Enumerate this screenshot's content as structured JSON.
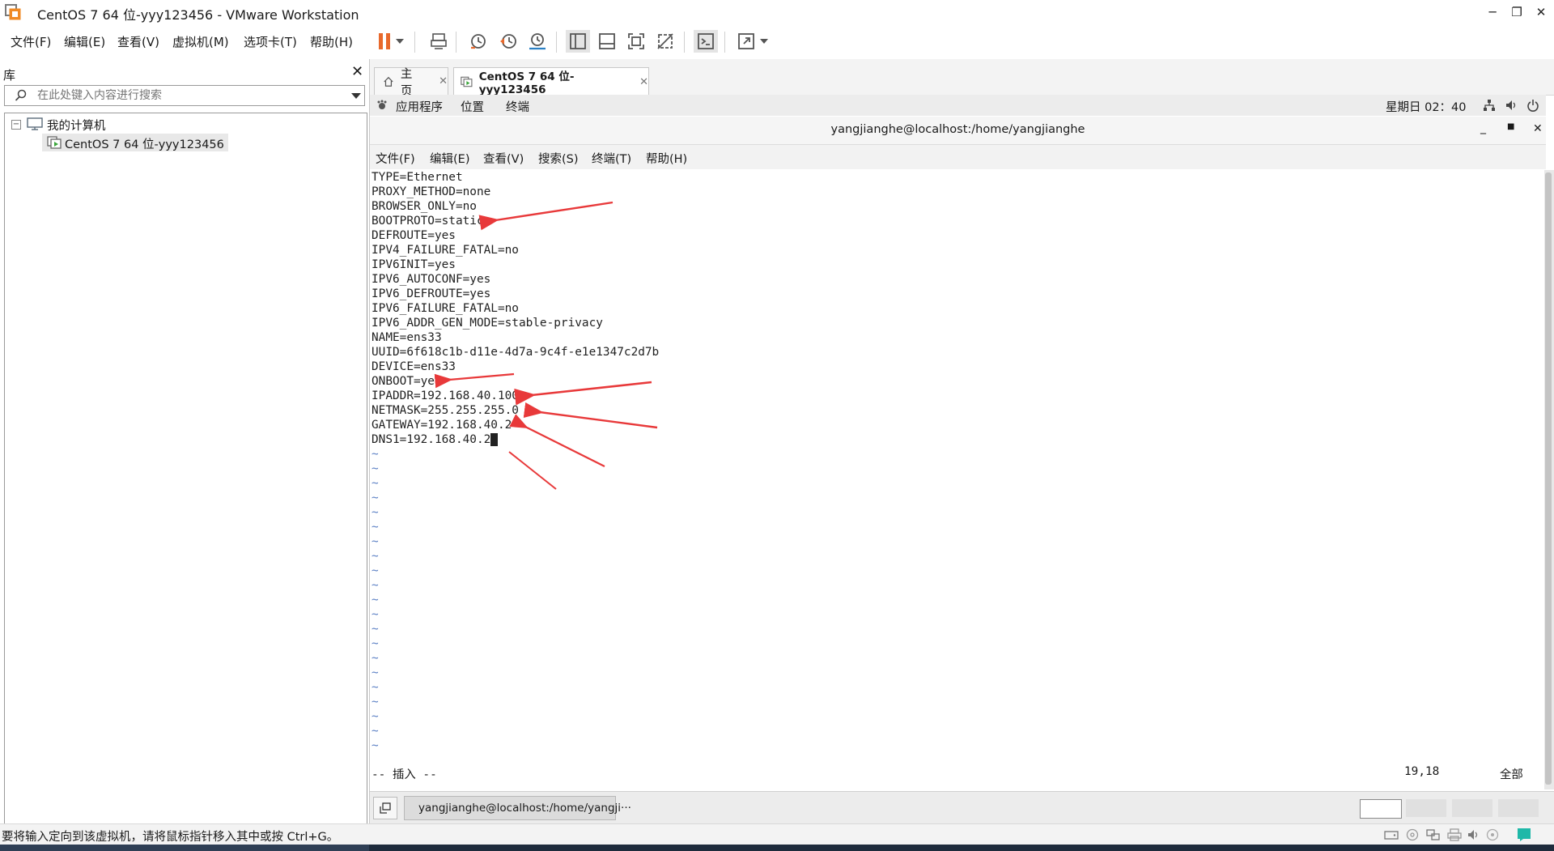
{
  "window": {
    "title": "CentOS 7 64 位-yyy123456 - VMware Workstation"
  },
  "menu": {
    "items": [
      "文件(F)",
      "编辑(E)",
      "查看(V)",
      "虚拟机(M)",
      "选项卡(T)",
      "帮助(H)"
    ]
  },
  "library": {
    "title": "库",
    "search_placeholder": "在此处键入内容进行搜索",
    "tree": {
      "root": "我的计算机",
      "child": "CentOS 7 64 位-yyy123456"
    }
  },
  "tabs": [
    {
      "label": "主页"
    },
    {
      "label": "CentOS 7 64 位-yyy123456"
    }
  ],
  "gnome": {
    "apps": "应用程序",
    "places": "位置",
    "terminal": "终端",
    "clock": "星期日 02：40"
  },
  "terminal": {
    "title": "yangjianghe@localhost:/home/yangjianghe",
    "menu": [
      "文件(F)",
      "编辑(E)",
      "查看(V)",
      "搜索(S)",
      "终端(T)",
      "帮助(H)"
    ],
    "lines": [
      "TYPE=Ethernet",
      "PROXY_METHOD=none",
      "BROWSER_ONLY=no",
      "BOOTPROTO=static",
      "DEFROUTE=yes",
      "IPV4_FAILURE_FATAL=no",
      "IPV6INIT=yes",
      "IPV6_AUTOCONF=yes",
      "IPV6_DEFROUTE=yes",
      "IPV6_FAILURE_FATAL=no",
      "IPV6_ADDR_GEN_MODE=stable-privacy",
      "NAME=ens33",
      "UUID=6f618c1b-d11e-4d7a-9c4f-e1e1347c2d7b",
      "DEVICE=ens33",
      "ONBOOT=yes",
      "IPADDR=192.168.40.100",
      "NETMASK=255.255.255.0",
      "GATEWAY=192.168.40.2",
      "DNS1=192.168.40.2"
    ],
    "tilde": "~",
    "mode": "-- 插入 --",
    "position": "19,18",
    "scroll": "全部"
  },
  "taskbar": {
    "task_label": "yangjianghe@localhost:/home/yangji···"
  },
  "status": {
    "message": "要将输入定向到该虚拟机，请将鼠标指针移入其中或按 Ctrl+G。"
  },
  "colors": {
    "accent_orange": "#e8692c",
    "annotation_red": "#e8393a",
    "tilde_blue": "#5a7fc4"
  }
}
